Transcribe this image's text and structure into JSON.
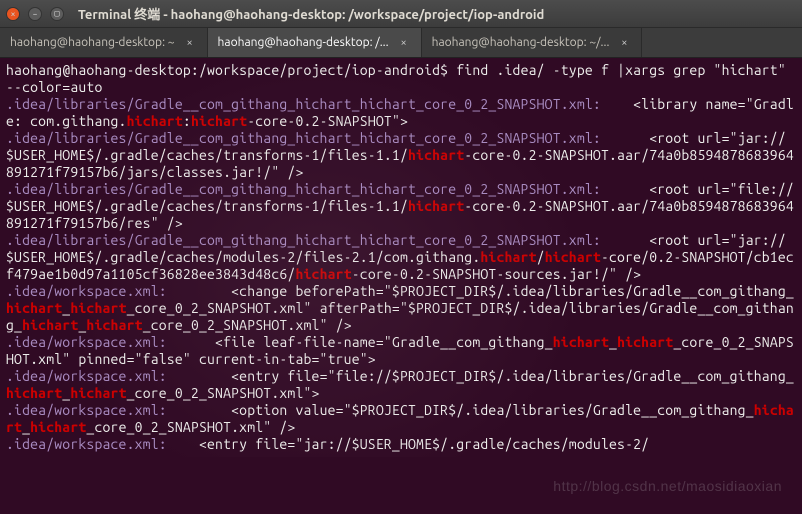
{
  "window": {
    "title": "Terminal 终端 - haohang@haohang-desktop: /workspace/project/iop-android"
  },
  "tabs": [
    {
      "label": "haohang@haohang-desktop: ~",
      "active": false
    },
    {
      "label": "haohang@haohang-desktop: /...",
      "active": true
    },
    {
      "label": "haohang@haohang-desktop: ~/...",
      "active": false
    }
  ],
  "prompt": "haohang@haohang-desktop:/workspace/project/iop-android$ ",
  "command": "find .idea/ -type f |xargs grep \"hichart\" --color=auto",
  "hl": "hichart",
  "lines": [
    {
      "file": ".idea/libraries/Gradle__com_githang_hichart_hichart_core_0_2_SNAPSHOT.xml:",
      "segs": [
        "    <library name=\"Gradle: com.githang.",
        "HL",
        ":",
        "HL",
        "-core-0.2-SNAPSHOT\">"
      ]
    },
    {
      "file": ".idea/libraries/Gradle__com_githang_hichart_hichart_core_0_2_SNAPSHOT.xml:",
      "segs": [
        "      <root url=\"jar://$USER_HOME$/.gradle/caches/transforms-1/files-1.1/",
        "HL",
        "-core-0.2-SNAPSHOT.aar/74a0b8594878683964891271f79157b6/jars/classes.jar!/\" />"
      ]
    },
    {
      "file": ".idea/libraries/Gradle__com_githang_hichart_hichart_core_0_2_SNAPSHOT.xml:",
      "segs": [
        "      <root url=\"file://$USER_HOME$/.gradle/caches/transforms-1/files-1.1/",
        "HL",
        "-core-0.2-SNAPSHOT.aar/74a0b8594878683964891271f79157b6/res\" />"
      ]
    },
    {
      "file": ".idea/libraries/Gradle__com_githang_hichart_hichart_core_0_2_SNAPSHOT.xml:",
      "segs": [
        "      <root url=\"jar://$USER_HOME$/.gradle/caches/modules-2/files-2.1/com.githang.",
        "HL",
        "/",
        "HL",
        "-core/0.2-SNAPSHOT/cb1ecf479ae1b0d97a1105cf36828ee3843d48c6/",
        "HL",
        "-core-0.2-SNAPSHOT-sources.jar!/\" />"
      ]
    },
    {
      "file": ".idea/workspace.xml:",
      "segs": [
        "        <change beforePath=\"$PROJECT_DIR$/.idea/libraries/Gradle__com_githang_",
        "HL",
        "_",
        "HL",
        "_core_0_2_SNAPSHOT.xml\" afterPath=\"$PROJECT_DIR$/.idea/libraries/Gradle__com_githang_",
        "HL",
        "_",
        "HL",
        "_core_0_2_SNAPSHOT.xml\" />"
      ]
    },
    {
      "file": ".idea/workspace.xml:",
      "segs": [
        "      <file leaf-file-name=\"Gradle__com_githang_",
        "HL",
        "_",
        "HL",
        "_core_0_2_SNAPSHOT.xml\" pinned=\"false\" current-in-tab=\"true\">"
      ]
    },
    {
      "file": ".idea/workspace.xml:",
      "segs": [
        "        <entry file=\"file://$PROJECT_DIR$/.idea/libraries/Gradle__com_githang_",
        "HL",
        "_",
        "HL",
        "_core_0_2_SNAPSHOT.xml\">"
      ]
    },
    {
      "file": ".idea/workspace.xml:",
      "segs": [
        "        <option value=\"$PROJECT_DIR$/.idea/libraries/Gradle__com_githang_",
        "HL",
        "_",
        "HL",
        "_core_0_2_SNAPSHOT.xml\" />"
      ]
    },
    {
      "file": ".idea/workspace.xml:",
      "segs": [
        "    <entry file=\"jar://$USER_HOME$/.gradle/caches/modules-2/"
      ]
    }
  ],
  "watermark": "http://blog.csdn.net/maosidiaoxian"
}
